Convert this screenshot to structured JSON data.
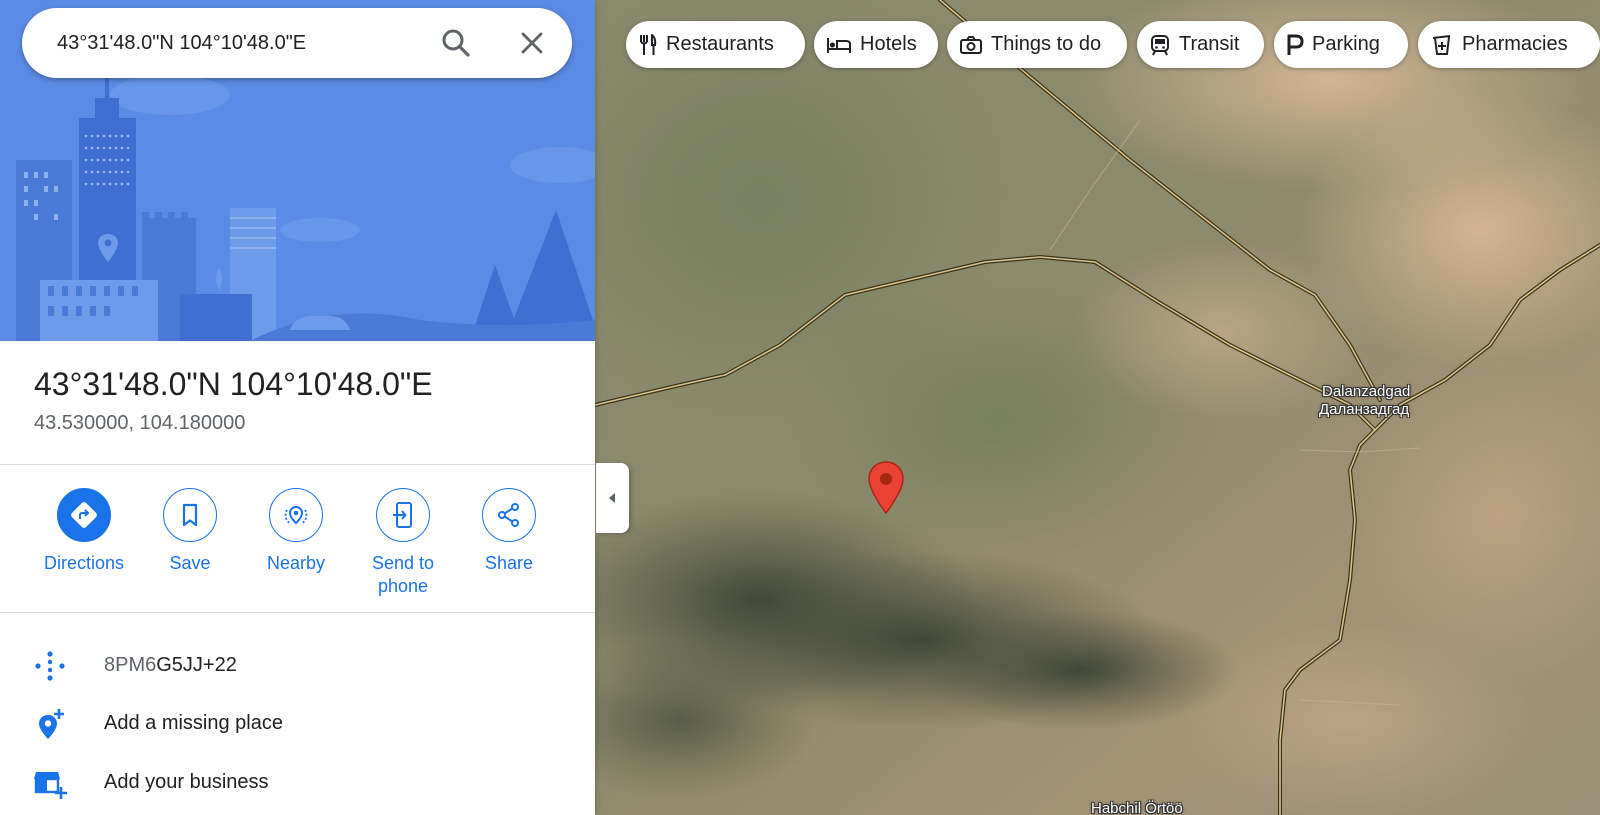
{
  "search": {
    "query": "43°31'48.0\"N 104°10'48.0\"E"
  },
  "place": {
    "title": "43°31'48.0\"N 104°10'48.0\"E",
    "decimal_coords": "43.530000, 104.180000"
  },
  "actions": [
    {
      "label": "Directions",
      "icon": "directions-icon"
    },
    {
      "label": "Save",
      "icon": "bookmark-icon"
    },
    {
      "label": "Nearby",
      "icon": "nearby-icon"
    },
    {
      "label": "Send to phone",
      "icon": "send-to-phone-icon"
    },
    {
      "label": "Share",
      "icon": "share-icon"
    }
  ],
  "info": {
    "plus_code_prefix": "8PM6",
    "plus_code_rest": "G5JJ+22",
    "add_missing_place": "Add a missing place",
    "add_business": "Add your business"
  },
  "chips": [
    {
      "label": "Restaurants",
      "icon": "restaurant-icon"
    },
    {
      "label": "Hotels",
      "icon": "hotel-icon"
    },
    {
      "label": "Things to do",
      "icon": "camera-icon"
    },
    {
      "label": "Transit",
      "icon": "transit-icon"
    },
    {
      "label": "Parking",
      "icon": "parking-icon"
    },
    {
      "label": "Pharmacies",
      "icon": "pharmacy-icon"
    }
  ],
  "map": {
    "labels": {
      "city_latin": "Dalanzadgad",
      "city_cyrillic": "Даланзадгад",
      "bottom_place": "Habchil Örtöö"
    }
  },
  "colors": {
    "accent": "#1a73e8",
    "pin": "#ea4335",
    "hero": "#5b8ce5"
  }
}
